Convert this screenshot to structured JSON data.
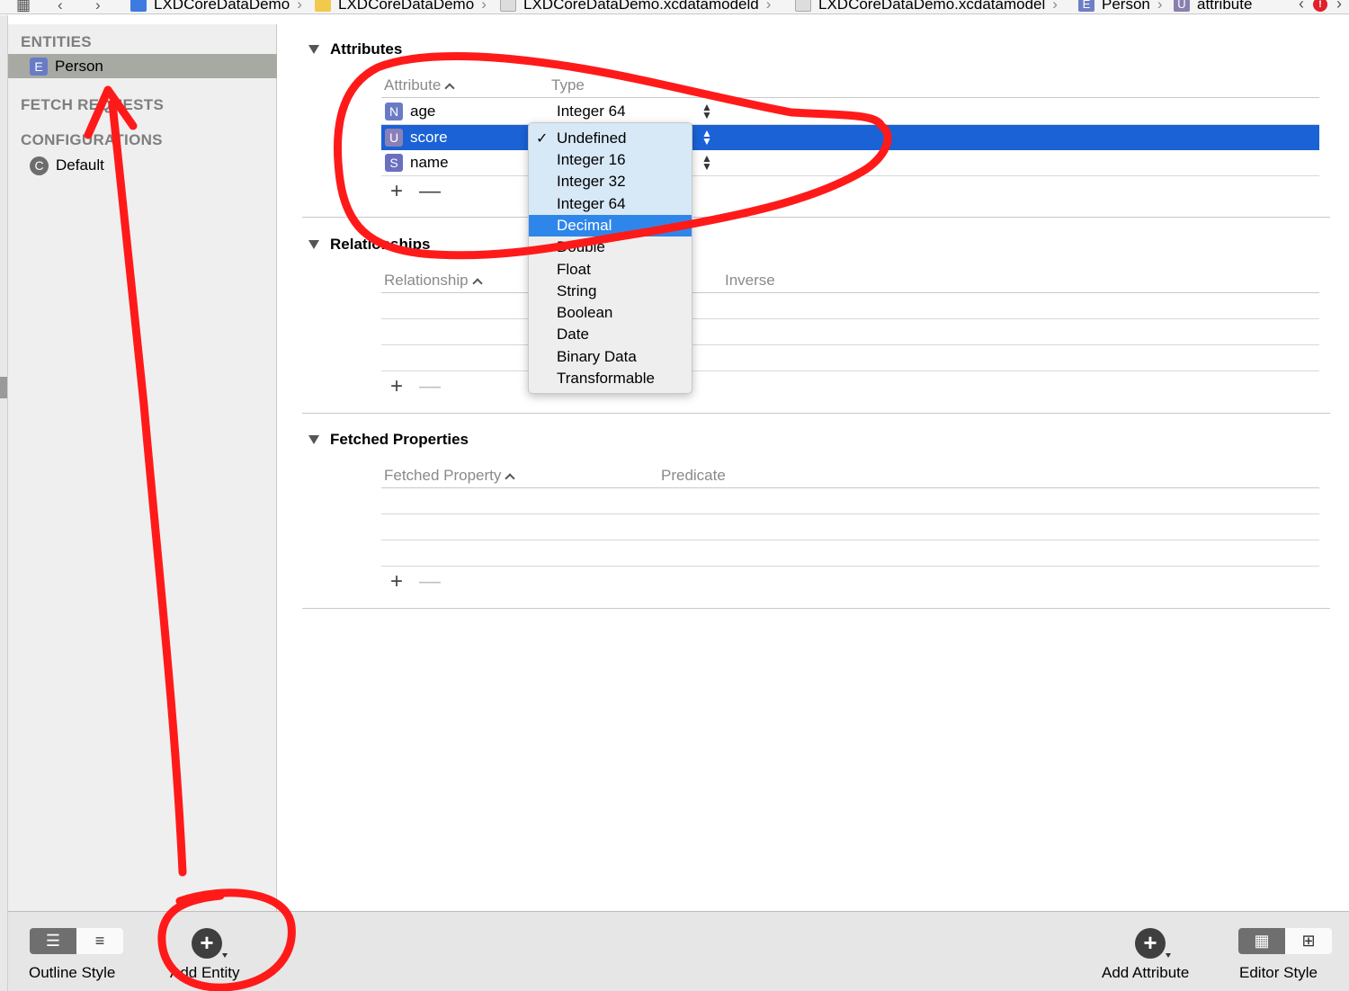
{
  "jumpbar": {
    "crumbs": [
      "LXDCoreDataDemo",
      "LXDCoreDataDemo",
      "LXDCoreDataDemo.xcdatamodeld",
      "LXDCoreDataDemo.xcdatamodel",
      "Person",
      "attribute"
    ],
    "entity_badge": "E",
    "attribute_badge": "U"
  },
  "sidebar": {
    "entities_header": "ENTITIES",
    "entities": [
      {
        "badge": "E",
        "label": "Person"
      }
    ],
    "fetch_requests_header": "FETCH REQUESTS",
    "configurations_header": "CONFIGURATIONS",
    "configurations": [
      {
        "badge": "C",
        "label": "Default"
      }
    ]
  },
  "attributes": {
    "title": "Attributes",
    "col_attribute": "Attribute",
    "col_type": "Type",
    "rows": [
      {
        "badge": "N",
        "name": "age",
        "type": "Integer 64"
      },
      {
        "badge": "U",
        "name": "score",
        "type": "Undefined"
      },
      {
        "badge": "S",
        "name": "name",
        "type": ""
      }
    ]
  },
  "relationships": {
    "title": "Relationships",
    "col_relationship": "Relationship",
    "col_inverse": "Inverse"
  },
  "fetched_properties": {
    "title": "Fetched Properties",
    "col_fetched_property": "Fetched Property",
    "col_predicate": "Predicate"
  },
  "type_menu": {
    "items": [
      "Undefined",
      "Integer 16",
      "Integer 32",
      "Integer 64",
      "Decimal",
      "Double",
      "Float",
      "String",
      "Boolean",
      "Date",
      "Binary Data",
      "Transformable"
    ],
    "checked": "Undefined",
    "highlighted": "Decimal",
    "check_glyph": "✓"
  },
  "bottombar": {
    "outline_style": "Outline Style",
    "add_entity": "Add Entity",
    "add_attribute": "Add Attribute",
    "editor_style": "Editor Style"
  },
  "controls": {
    "plus": "+",
    "minus": "—"
  },
  "colors": {
    "selection": "#1a62d6",
    "menu_highlight": "#2f86ea",
    "sidebar_selection": "#a6aaa3",
    "annotation_ink": "#ff1a1a"
  },
  "icons": [
    "grid-icon",
    "back-chevron-icon",
    "forward-chevron-icon",
    "disclosure-triangle-icon",
    "stepper-icon",
    "checkmark-icon",
    "plus-icon",
    "minus-icon",
    "add-circle-icon",
    "table-style-icon",
    "graph-style-icon",
    "outline-list-icon",
    "error-icon"
  ]
}
